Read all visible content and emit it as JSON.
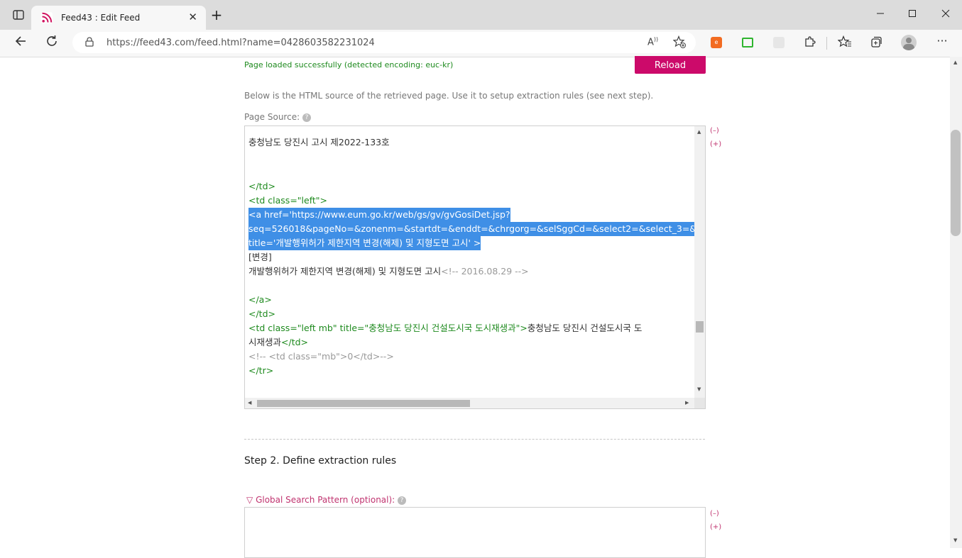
{
  "browser": {
    "tab_title": "Feed43 : Edit Feed",
    "url": "https://feed43.com/feed.html?name=0428603582231024",
    "tab_icon": "rss-icon",
    "controls": {
      "minimize": "minimize-icon",
      "maximize": "maximize-icon",
      "close": "close-icon"
    }
  },
  "page": {
    "status": "Page loaded successfully (detected encoding: euc-kr)",
    "reload_label": "Reload",
    "intro": "Below is the HTML source of the retrieved page. Use it to setup extraction rules (see next step).",
    "page_source_label": "Page Source:",
    "help_glyph": "?",
    "collapse_glyph": "(–)",
    "expand_glyph": "(+)",
    "step2_title": "Step 2. Define extraction rules",
    "gsp_arrow": "▽",
    "gsp_label": "Global Search Pattern (optional):",
    "source_lines": [
      {
        "t": "충청남도 당진시 고시 제2022-133호",
        "c": "plain"
      },
      {
        "t": "</td>",
        "c": "tag"
      },
      {
        "t": "<td class=\"left\">",
        "c": "tag"
      },
      {
        "t": "<a href='https://www.eum.go.kr/web/gs/gv/gvGosiDet.jsp?",
        "c": "sel"
      },
      {
        "t": "seq=526018&pageNo=&zonenm=&startdt=&enddt=&chrgorg=&selSggCd=&select2=&select_3=&",
        "c": "sel"
      },
      {
        "t": "title='개발행위허가 제한지역 변경(해제) 및 지형도면 고시' >",
        "c": "sel"
      },
      {
        "t": "[변경]",
        "c": "plain"
      },
      {
        "t": "개발행위허가 제한지역 변경(해제) 및 지형도면 고시",
        "c": "plain"
      },
      {
        "t": "<!-- 2016.08.29 -->",
        "c": "comment"
      },
      {
        "t": "</a>",
        "c": "tag"
      },
      {
        "t": "</td>",
        "c": "tag"
      },
      {
        "t": "<td class=\"left mb\" title=\"충청남도 당진시 건설도시국 도시재생과\">",
        "c": "tag"
      },
      {
        "t": "충청남도 당진시 건설도시국 도",
        "c": "plain"
      },
      {
        "t": "시재생과",
        "c": "plain"
      },
      {
        "t": "</td>",
        "c": "tag"
      },
      {
        "t": "<!-- <td class=\"mb\">0</td>-->",
        "c": "comment"
      },
      {
        "t": "</tr>",
        "c": "tag"
      }
    ]
  }
}
